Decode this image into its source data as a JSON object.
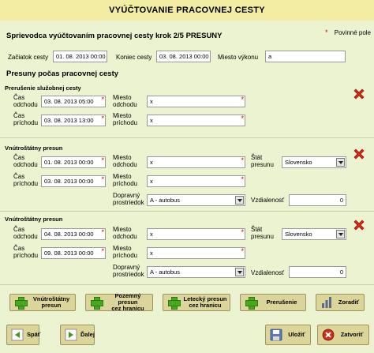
{
  "title": "VYÚČTOVANIE PRACOVNEJ CESTY",
  "wizard_heading": "Sprievodca vyúčtovaním pracovnej cesty krok 2/5 PRESUNY",
  "required_note": "Povinné pole",
  "trip": {
    "start_label": "Začiatok cesty",
    "start_value": "01. 08. 2013 00:00",
    "end_label": "Koniec cesty",
    "end_value": "03. 08. 2013 00:00",
    "place_label": "Miesto výkonu",
    "place_value": "a"
  },
  "moves_heading": "Presuny počas pracovnej cesty",
  "labels": {
    "departure_time": [
      "Čas",
      "odchodu"
    ],
    "arrival_time": [
      "Čas",
      "príchodu"
    ],
    "departure_place": [
      "Miesto",
      "odchodu"
    ],
    "arrival_place": [
      "Miesto",
      "príchodu"
    ],
    "country": [
      "Štát",
      "presunu"
    ],
    "transport": [
      "Dopravný",
      "prostriedok"
    ],
    "distance": "Vzdialenosť"
  },
  "segments": [
    {
      "type": "Prerušenie služobnej cesty",
      "departure_time": "03. 08. 2013 05:00",
      "arrival_time": "03. 08. 2013 13:00",
      "departure_place": "x",
      "arrival_place": "x"
    },
    {
      "type": "Vnútroštátny presun",
      "departure_time": "01. 08. 2013 00:00",
      "arrival_time": "03. 08. 2013 00:00",
      "departure_place": "x",
      "arrival_place": "x",
      "country": "Slovensko",
      "transport": "A - autobus",
      "distance": "0"
    },
    {
      "type": "Vnútroštátny presun",
      "departure_time": "04. 08. 2013 00:00",
      "arrival_time": "09. 08. 2013 00:00",
      "departure_place": "x",
      "arrival_place": "x",
      "country": "Slovensko",
      "transport": "A - autobus",
      "distance": "0"
    }
  ],
  "add_buttons": {
    "domestic": [
      "Vnútroštátny",
      "presun"
    ],
    "ground_border": [
      "Pozemný presun",
      "cez hranicu"
    ],
    "air_border": [
      "Letecký presun",
      "cez hranicu"
    ],
    "interruption": "Prerušenie",
    "sort": "Zoradiť"
  },
  "nav_buttons": {
    "back": "Späť",
    "next": "Ďalej",
    "save": "Uložiť",
    "close": "Zatvoriť"
  },
  "colors": {
    "title_bar": "#f2eda3",
    "panel": "#ecf3d0",
    "button": "#dcd59a",
    "required": "#d40000",
    "delete": "#d22a1a",
    "add": "#4aa81f"
  },
  "icons": [
    "delete-icon",
    "plus-icon",
    "sort-icon",
    "back-icon",
    "next-icon",
    "save-icon",
    "close-icon"
  ]
}
